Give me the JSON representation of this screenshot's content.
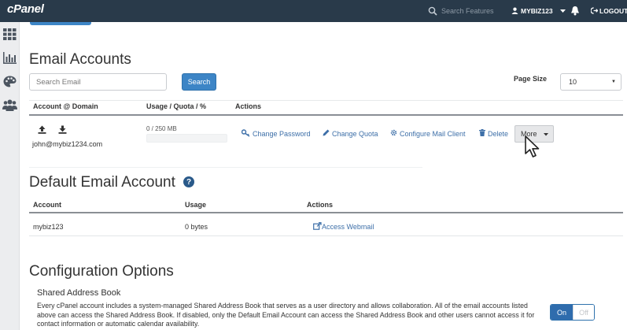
{
  "topbar": {
    "logo": "cPanel",
    "search_placeholder": "Search Features",
    "username": "MYBIZ123",
    "logout_label": "LOGOUT"
  },
  "colors": {
    "topbar_bg": "#293a4a",
    "accent_blue": "#3d85c6",
    "link_blue": "#3d6fa8",
    "quota_bar_fill": "#5cb85c"
  },
  "sidebar": {
    "icons": [
      "grid-icon",
      "bar-chart-icon",
      "palette-icon",
      "users-icon"
    ]
  },
  "email_accounts": {
    "title": "Email Accounts",
    "search_placeholder": "Search Email",
    "search_button": "Search",
    "page_size_label": "Page Size",
    "page_size_value": "10",
    "columns": [
      "Account @ Domain",
      "Usage / Quota / %",
      "Actions"
    ],
    "rows": [
      {
        "email": "john@mybiz1234.com",
        "quota_text": "0 / 250 MB",
        "usage_fraction": 0,
        "actions": {
          "change_password": "Change Password",
          "change_quota": "Change Quota",
          "configure_mail_client": "Configure Mail Client",
          "delete": "Delete",
          "more": "More"
        }
      }
    ]
  },
  "default_email_account": {
    "title": "Default Email Account",
    "columns": [
      "Account",
      "Usage",
      "Actions"
    ],
    "rows": [
      {
        "account": "mybiz123",
        "usage": "0 bytes",
        "action": "Access Webmail"
      }
    ]
  },
  "configuration": {
    "title": "Configuration Options",
    "subtitle": "Shared Address Book",
    "description": "Every cPanel account includes a system-managed Shared Address Book that serves as a user directory and allows collaboration. All of the email accounts listed above can access the Shared Address Book. If disabled, only the Default Email Account can access the Shared Address Book and other users cannot access it for contact information or automatic calendar availability.",
    "toggle_on": "On",
    "toggle_off": "Off"
  }
}
